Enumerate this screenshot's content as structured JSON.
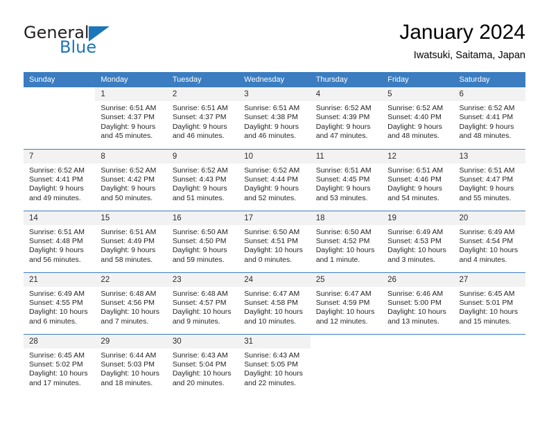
{
  "brand": {
    "name_part1": "General",
    "name_part2": "Blue"
  },
  "header": {
    "month_title": "January 2024",
    "location": "Iwatsuki, Saitama, Japan"
  },
  "colors": {
    "header_blue": "#3b7dc0",
    "logo_blue": "#1b75bb",
    "daynum_bg": "#f2f2f2"
  },
  "weekday_headers": [
    "Sunday",
    "Monday",
    "Tuesday",
    "Wednesday",
    "Thursday",
    "Friday",
    "Saturday"
  ],
  "weeks": [
    [
      {
        "day": "",
        "lines": []
      },
      {
        "day": "1",
        "lines": [
          "Sunrise: 6:51 AM",
          "Sunset: 4:37 PM",
          "Daylight: 9 hours",
          "and 45 minutes."
        ]
      },
      {
        "day": "2",
        "lines": [
          "Sunrise: 6:51 AM",
          "Sunset: 4:37 PM",
          "Daylight: 9 hours",
          "and 46 minutes."
        ]
      },
      {
        "day": "3",
        "lines": [
          "Sunrise: 6:51 AM",
          "Sunset: 4:38 PM",
          "Daylight: 9 hours",
          "and 46 minutes."
        ]
      },
      {
        "day": "4",
        "lines": [
          "Sunrise: 6:52 AM",
          "Sunset: 4:39 PM",
          "Daylight: 9 hours",
          "and 47 minutes."
        ]
      },
      {
        "day": "5",
        "lines": [
          "Sunrise: 6:52 AM",
          "Sunset: 4:40 PM",
          "Daylight: 9 hours",
          "and 48 minutes."
        ]
      },
      {
        "day": "6",
        "lines": [
          "Sunrise: 6:52 AM",
          "Sunset: 4:41 PM",
          "Daylight: 9 hours",
          "and 48 minutes."
        ]
      }
    ],
    [
      {
        "day": "7",
        "lines": [
          "Sunrise: 6:52 AM",
          "Sunset: 4:41 PM",
          "Daylight: 9 hours",
          "and 49 minutes."
        ]
      },
      {
        "day": "8",
        "lines": [
          "Sunrise: 6:52 AM",
          "Sunset: 4:42 PM",
          "Daylight: 9 hours",
          "and 50 minutes."
        ]
      },
      {
        "day": "9",
        "lines": [
          "Sunrise: 6:52 AM",
          "Sunset: 4:43 PM",
          "Daylight: 9 hours",
          "and 51 minutes."
        ]
      },
      {
        "day": "10",
        "lines": [
          "Sunrise: 6:52 AM",
          "Sunset: 4:44 PM",
          "Daylight: 9 hours",
          "and 52 minutes."
        ]
      },
      {
        "day": "11",
        "lines": [
          "Sunrise: 6:51 AM",
          "Sunset: 4:45 PM",
          "Daylight: 9 hours",
          "and 53 minutes."
        ]
      },
      {
        "day": "12",
        "lines": [
          "Sunrise: 6:51 AM",
          "Sunset: 4:46 PM",
          "Daylight: 9 hours",
          "and 54 minutes."
        ]
      },
      {
        "day": "13",
        "lines": [
          "Sunrise: 6:51 AM",
          "Sunset: 4:47 PM",
          "Daylight: 9 hours",
          "and 55 minutes."
        ]
      }
    ],
    [
      {
        "day": "14",
        "lines": [
          "Sunrise: 6:51 AM",
          "Sunset: 4:48 PM",
          "Daylight: 9 hours",
          "and 56 minutes."
        ]
      },
      {
        "day": "15",
        "lines": [
          "Sunrise: 6:51 AM",
          "Sunset: 4:49 PM",
          "Daylight: 9 hours",
          "and 58 minutes."
        ]
      },
      {
        "day": "16",
        "lines": [
          "Sunrise: 6:50 AM",
          "Sunset: 4:50 PM",
          "Daylight: 9 hours",
          "and 59 minutes."
        ]
      },
      {
        "day": "17",
        "lines": [
          "Sunrise: 6:50 AM",
          "Sunset: 4:51 PM",
          "Daylight: 10 hours",
          "and 0 minutes."
        ]
      },
      {
        "day": "18",
        "lines": [
          "Sunrise: 6:50 AM",
          "Sunset: 4:52 PM",
          "Daylight: 10 hours",
          "and 1 minute."
        ]
      },
      {
        "day": "19",
        "lines": [
          "Sunrise: 6:49 AM",
          "Sunset: 4:53 PM",
          "Daylight: 10 hours",
          "and 3 minutes."
        ]
      },
      {
        "day": "20",
        "lines": [
          "Sunrise: 6:49 AM",
          "Sunset: 4:54 PM",
          "Daylight: 10 hours",
          "and 4 minutes."
        ]
      }
    ],
    [
      {
        "day": "21",
        "lines": [
          "Sunrise: 6:49 AM",
          "Sunset: 4:55 PM",
          "Daylight: 10 hours",
          "and 6 minutes."
        ]
      },
      {
        "day": "22",
        "lines": [
          "Sunrise: 6:48 AM",
          "Sunset: 4:56 PM",
          "Daylight: 10 hours",
          "and 7 minutes."
        ]
      },
      {
        "day": "23",
        "lines": [
          "Sunrise: 6:48 AM",
          "Sunset: 4:57 PM",
          "Daylight: 10 hours",
          "and 9 minutes."
        ]
      },
      {
        "day": "24",
        "lines": [
          "Sunrise: 6:47 AM",
          "Sunset: 4:58 PM",
          "Daylight: 10 hours",
          "and 10 minutes."
        ]
      },
      {
        "day": "25",
        "lines": [
          "Sunrise: 6:47 AM",
          "Sunset: 4:59 PM",
          "Daylight: 10 hours",
          "and 12 minutes."
        ]
      },
      {
        "day": "26",
        "lines": [
          "Sunrise: 6:46 AM",
          "Sunset: 5:00 PM",
          "Daylight: 10 hours",
          "and 13 minutes."
        ]
      },
      {
        "day": "27",
        "lines": [
          "Sunrise: 6:45 AM",
          "Sunset: 5:01 PM",
          "Daylight: 10 hours",
          "and 15 minutes."
        ]
      }
    ],
    [
      {
        "day": "28",
        "lines": [
          "Sunrise: 6:45 AM",
          "Sunset: 5:02 PM",
          "Daylight: 10 hours",
          "and 17 minutes."
        ]
      },
      {
        "day": "29",
        "lines": [
          "Sunrise: 6:44 AM",
          "Sunset: 5:03 PM",
          "Daylight: 10 hours",
          "and 18 minutes."
        ]
      },
      {
        "day": "30",
        "lines": [
          "Sunrise: 6:43 AM",
          "Sunset: 5:04 PM",
          "Daylight: 10 hours",
          "and 20 minutes."
        ]
      },
      {
        "day": "31",
        "lines": [
          "Sunrise: 6:43 AM",
          "Sunset: 5:05 PM",
          "Daylight: 10 hours",
          "and 22 minutes."
        ]
      },
      {
        "day": "",
        "lines": []
      },
      {
        "day": "",
        "lines": []
      },
      {
        "day": "",
        "lines": []
      }
    ]
  ]
}
